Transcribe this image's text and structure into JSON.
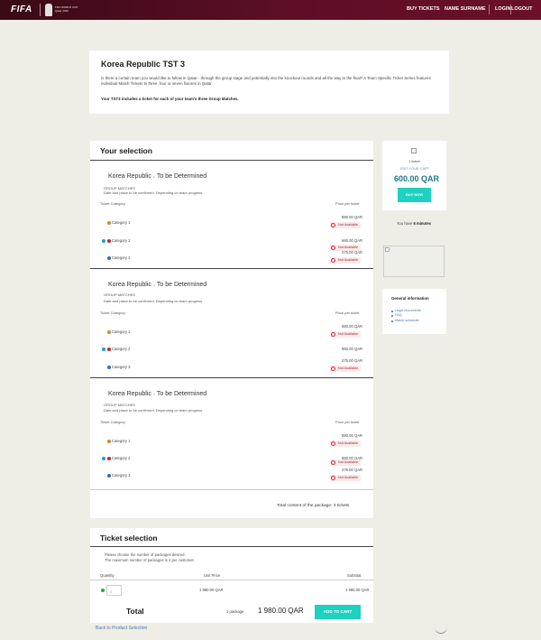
{
  "header": {
    "logo": "FIFA",
    "wc_text": "FIFA WORLD CUP Qatar 2022",
    "nav": [
      "BUY TICKETS",
      "NAME SURNAME",
      "LOGIN",
      "LOGOUT"
    ]
  },
  "intro": {
    "title": "Korea Republic TST 3",
    "text": "Is there a certain team you would like to follow in Qatar - through the group stage and potentially into the knockout rounds and all the way to the final? A Team Specific Ticket Series features individual Match Tickets to three, four or seven fixtures in Qatar.",
    "bold": "Your TST3 includes a ticket for each of your team's three Group Matches."
  },
  "selection": {
    "title": "Your selection",
    "matches": [
      {
        "team": "Korea Republic",
        "vs": "v",
        "opponent": "To be Determined",
        "stage": "GROUP MATCHES",
        "note": "Date and place to be confirmed. Depending on team progress",
        "col_category": "Ticket Category",
        "col_price": "Price per ticket",
        "categories": [
          {
            "label": "Category 1",
            "price": "880.00 QAR",
            "status": "Not Available"
          },
          {
            "label": "Category 2",
            "price": "660.00 QAR",
            "status": "Not Available"
          },
          {
            "label": "Category 3",
            "price": "275.00 QAR",
            "status": "Not Available"
          }
        ]
      },
      {
        "team": "Korea Republic",
        "vs": "v",
        "opponent": "To be Determined",
        "stage": "GROUP MATCHES",
        "note": "Date and place to be confirmed. Depending on team progress",
        "col_category": "Ticket Category",
        "col_price": "Price per ticket",
        "categories": [
          {
            "label": "Category 1",
            "price": "880.00 QAR",
            "status": "Not Available"
          },
          {
            "label": "Category 2",
            "price": "660.00 QAR",
            "status": ""
          },
          {
            "label": "Category 3",
            "price": "275.00 QAR",
            "status": "Not Available"
          }
        ]
      },
      {
        "team": "Korea Republic",
        "vs": "v",
        "opponent": "To be Determined",
        "stage": "GROUP MATCHES",
        "note": "Date and place to be confirmed. Depending on team progress",
        "col_category": "Ticket Category",
        "col_price": "Price per ticket",
        "categories": [
          {
            "label": "Category 1",
            "price": "880.00 QAR",
            "status": "Not Available"
          },
          {
            "label": "Category 2",
            "price": "660.00 QAR",
            "status": "Not Available"
          },
          {
            "label": "Category 3",
            "price": "275.00 QAR",
            "status": "Not Available"
          }
        ]
      }
    ],
    "total_text": "Total content of the package: 3 tickets"
  },
  "ticket_selection": {
    "title": "Ticket selection",
    "instruction1": "Please choose the number of packages desired.",
    "instruction2": "The maximum number of packages is 4 per customer.",
    "col_quantity": "Quantity",
    "col_unit_price": "Unit Price",
    "col_subtotal": "Subtotal",
    "quantity_value": "0",
    "unit_price": "1 980.00 QAR",
    "subtotal": "1 980.00 QAR",
    "total_label": "Total",
    "package_text": "1 package",
    "total_price": "1 980.00 QAR",
    "add_to_cart": "ADD TO CART",
    "back_link": "Back to Product Selection"
  },
  "sidebar": {
    "tickets_label": "1 ticket",
    "edit_cart": "EDIT YOUR CART",
    "price": "600.00 QAR",
    "buy_now": "BUY NOW",
    "timer_prefix": "You have",
    "timer_value": "6 minutes",
    "general_info": {
      "title": "General information",
      "links": [
        "Legal documents",
        "FAQ",
        "Match schedule"
      ]
    }
  },
  "colors": {
    "header": "#5b0e25",
    "accent": "#1ed1c0",
    "cat1": "#c98a2a",
    "cat2": "#c0262b",
    "cat3": "#2a6ac0",
    "cat2_extra": "#1aa0d8",
    "not_available": "#d0263a"
  }
}
